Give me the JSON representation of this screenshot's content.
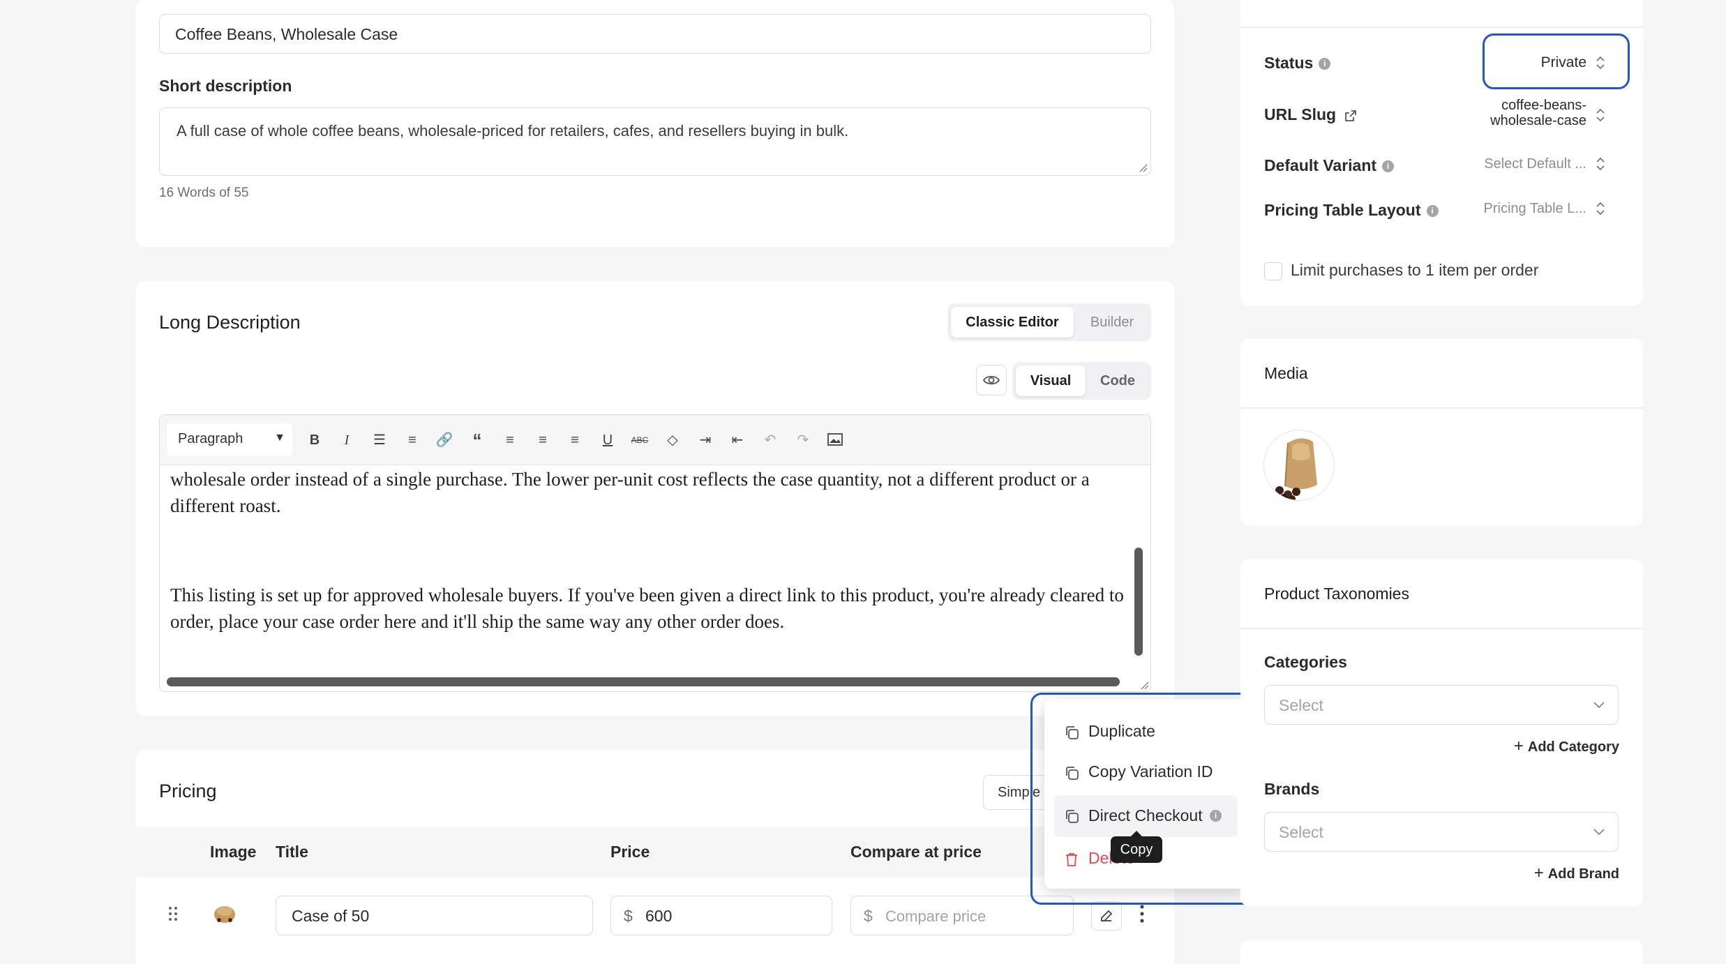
{
  "product": {
    "title_value": "Coffee Beans, Wholesale Case",
    "short_description_label": "Short description",
    "short_description_value": "A full case of whole coffee beans, wholesale-priced for retailers, cafes, and resellers buying in bulk.",
    "word_count": "16 Words of 55"
  },
  "long_description": {
    "heading": "Long Description",
    "editor_modes": [
      "Classic Editor",
      "Builder"
    ],
    "view_modes": [
      "Visual",
      "Code"
    ],
    "paragraph_select": "Paragraph",
    "paragraph_1": "wholesale order instead of a single purchase. The lower per-unit cost reflects the case quantity, not a different product or a different roast.",
    "paragraph_2": "This listing is set up for approved wholesale buyers. If you've been given a direct link to this product, you're already cleared to order, place your case order here and it'll ship the same way any other order does."
  },
  "toolbar_icons": [
    "bold-icon",
    "italic-icon",
    "bullet-list-icon",
    "numbered-list-icon",
    "link-icon",
    "blockquote-icon",
    "align-left-icon",
    "align-center-icon",
    "align-right-icon",
    "underline-icon",
    "strikethrough-icon",
    "clear-format-icon",
    "indent-icon",
    "outdent-icon",
    "undo-icon",
    "redo-icon",
    "image-icon"
  ],
  "pricing": {
    "heading": "Pricing",
    "mode_button": "Simple",
    "columns": [
      "Image",
      "Title",
      "Price",
      "Compare at price"
    ],
    "row": {
      "title": "Case of 50",
      "currency": "$",
      "price": "600",
      "compare_placeholder": "Compare price"
    }
  },
  "context_menu": {
    "items": [
      "Duplicate",
      "Copy Variation ID",
      "Direct Checkout",
      "Delete"
    ],
    "tooltip": "Copy",
    "delete_color": "#e5484d"
  },
  "settings": {
    "status_label": "Status",
    "status_value": "Private",
    "url_slug_label": "URL Slug",
    "url_slug_value_line1": "coffee-beans-",
    "url_slug_value_line2": "wholesale-case",
    "default_variant_label": "Default Variant",
    "default_variant_value": "Select Default ...",
    "pricing_table_label": "Pricing Table Layout",
    "pricing_table_value": "Pricing Table L...",
    "limit_label": "Limit purchases to 1 item per order"
  },
  "media": {
    "heading": "Media"
  },
  "taxonomies": {
    "heading": "Product Taxonomies",
    "categories_label": "Categories",
    "categories_placeholder": "Select",
    "add_category": "Add Category",
    "brands_label": "Brands",
    "brands_placeholder": "Select",
    "add_brand": "Add Brand"
  },
  "colors": {
    "highlight": "#1b56d8",
    "background": "#f6f6f7",
    "card": "#ffffff"
  }
}
